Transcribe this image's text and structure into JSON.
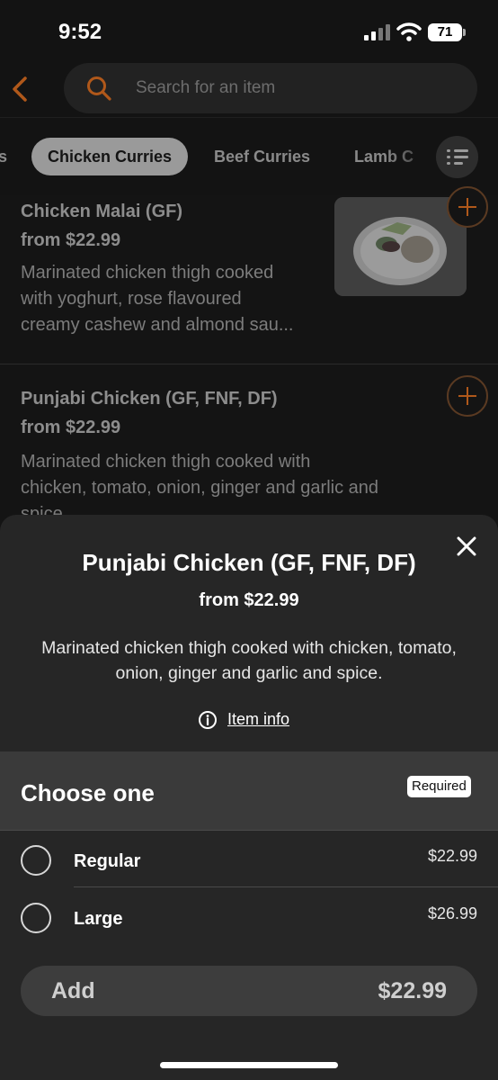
{
  "status_bar": {
    "time": "9:52",
    "battery": "71"
  },
  "search": {
    "placeholder": "Search for an item"
  },
  "tabs": [
    {
      "label": "s"
    },
    {
      "label": "Chicken Curries"
    },
    {
      "label": "Beef Curries"
    },
    {
      "label": "Lamb C"
    }
  ],
  "menu_items": [
    {
      "name": "Chicken Malai (GF)",
      "price": "from $22.99",
      "description_lines": [
        "Marinated chicken thigh cooked",
        "with yoghurt, rose flavoured",
        "creamy cashew and almond sau..."
      ]
    },
    {
      "name": "Punjabi Chicken (GF, FNF, DF)",
      "price": "from $22.99",
      "description_lines": [
        "Marinated chicken thigh cooked with",
        "chicken, tomato, onion, ginger and garlic and",
        "spice"
      ]
    }
  ],
  "sheet": {
    "title": "Punjabi Chicken (GF, FNF, DF)",
    "price": "from $22.99",
    "description": "Marinated chicken thigh cooked with chicken, tomato, onion, ginger and garlic and spice.",
    "item_info_label": "Item info",
    "choose_title": "Choose one",
    "required_label": "Required",
    "options": [
      {
        "label": "Regular",
        "price": "$22.99"
      },
      {
        "label": "Large",
        "price": "$26.99"
      }
    ],
    "add_label": "Add",
    "add_price": "$22.99"
  },
  "colors": {
    "accent": "#b0581a",
    "sheet_background": "#262626",
    "page_background": "#141414"
  },
  "icons": [
    "back-chevron-icon",
    "search-icon",
    "filter-icon",
    "add-icon",
    "close-icon",
    "info-icon",
    "signal-icon",
    "wifi-icon",
    "battery-icon"
  ]
}
